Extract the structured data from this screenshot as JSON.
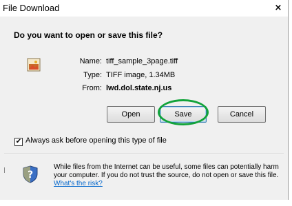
{
  "window": {
    "title": "File Download",
    "close": "×"
  },
  "question": "Do you want to open or save this file?",
  "file": {
    "name_label": "Name:",
    "name": "tiff_sample_3page.tiff",
    "type_label": "Type:",
    "type": "TIFF image, 1.34MB",
    "from_label": "From:",
    "from": "lwd.dol.state.nj.us",
    "icon": "tiff-file-icon"
  },
  "buttons": {
    "open": "Open",
    "save": "Save",
    "cancel": "Cancel"
  },
  "checkbox": {
    "checked": true,
    "mark": "✔",
    "label": "Always ask before opening this type of file"
  },
  "warning": {
    "icon": "shield-icon",
    "text": "While files from the Internet can be useful, some files can potentially harm your computer. If you do not trust the source, do not open or save this file.",
    "link": "What's the risk?"
  },
  "colors": {
    "highlight": "#11a33a",
    "link": "#0066cc",
    "dialog_bg": "#f0f0f0"
  }
}
